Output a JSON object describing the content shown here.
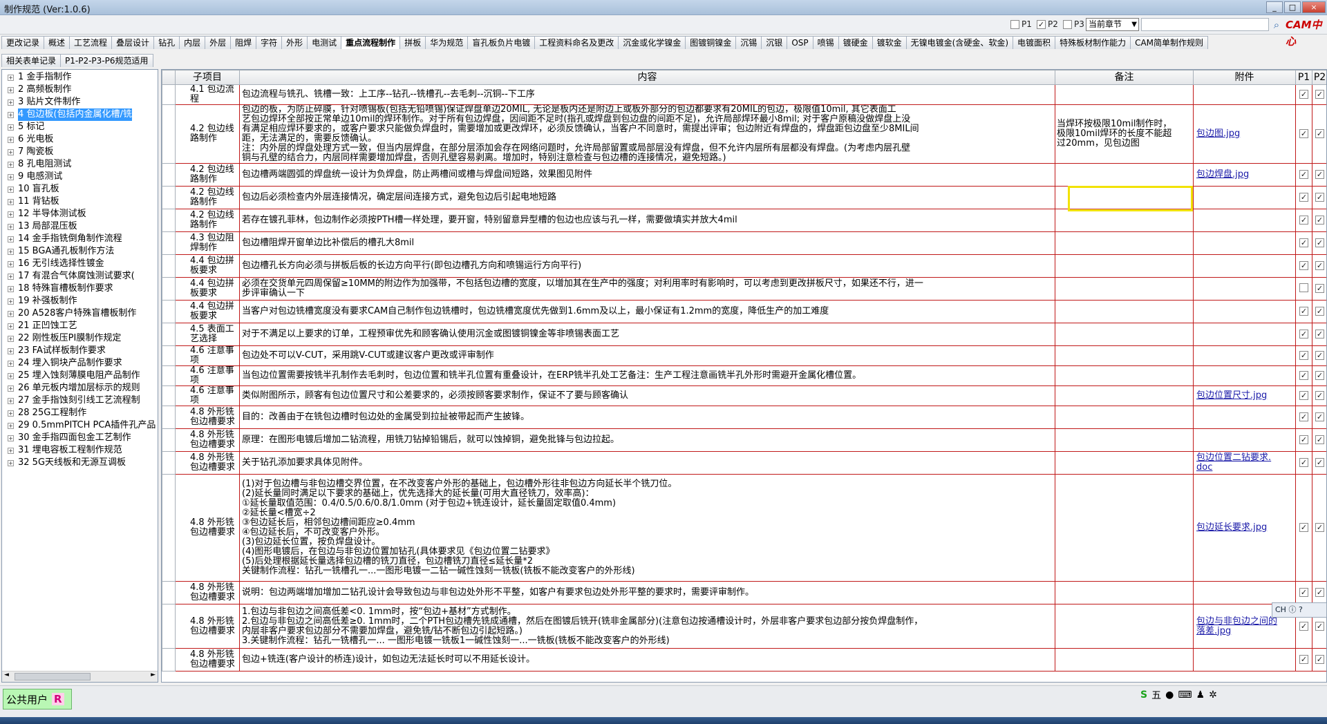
{
  "window": {
    "title": "制作规范 (Ver:1.0.6)",
    "controls": [
      "_",
      "□",
      "×"
    ]
  },
  "toolbar": {
    "p1": "P1",
    "p2": "P2",
    "p3": "P3",
    "chapter": "当前章节",
    "logo": "CAM中心"
  },
  "tabs": [
    "更改记录",
    "概述",
    "工艺流程",
    "叠层设计",
    "钻孔",
    "内层",
    "外层",
    "阻焊",
    "字符",
    "外形",
    "电测试",
    "重点流程制作",
    "拼板",
    "华为规范",
    "盲孔板负片电镀",
    "工程资料命名及更改",
    "沉金或化学镍金",
    "图镀铜镍金",
    "沉锡",
    "沉银",
    "OSP",
    "喷锡",
    "镀硬金",
    "镀软金",
    "无镍电镀金(含硬金、软金)",
    "电镀面积",
    "特殊板材制作能力",
    "CAM简单制作规则"
  ],
  "active_tab": "重点流程制作",
  "tabs2": [
    "相关表单记录",
    "P1-P2-P3-P6规范适用"
  ],
  "sidebar": [
    "1  金手指制作",
    "2  高频板制作",
    "3  贴片文件制作",
    "4  包边板(包括内金属化槽/铣",
    "5  标记",
    "6  光电板",
    "7  陶瓷板",
    "8  孔电阻测试",
    "9  电感测试",
    "10  盲孔板",
    "11  背钻板",
    "12  半导体测试板",
    "13  局部混压板",
    "14  金手指铣倒角制作流程",
    "15  BGA通孔板制作方法",
    "16  无引线选择性镀金",
    "17  有混合气体腐蚀测试要求(",
    "18  特殊盲槽板制作要求",
    "19  补强板制作",
    "20  A528客户特殊盲槽板制作",
    "21  正凹蚀工艺",
    "22  刚性板压PI膜制作规定",
    "23  FA试样板制作要求",
    "24  埋入铜块产品制作要求",
    "25  埋入蚀刻薄膜电阻产品制作",
    "26  单元板内增加层标示的规则",
    "27  金手指蚀刻引线工艺流程制",
    "28  25G工程制作",
    "29  0.5mmPITCH PCA插件孔产品",
    "30  金手指四面包金工艺制作",
    "31  埋电容板工程制作规范",
    "32  5G天线板和无源互调板"
  ],
  "selected_index": 3,
  "columns": {
    "sub": "子项目",
    "content": "内容",
    "note": "备注",
    "att": "附件",
    "p1": "P1",
    "p2": "P2",
    "p3": "P3"
  },
  "rows": [
    {
      "sub": "4.1 包边流程",
      "content": [
        "包边流程与铣孔、铣槽一致：上工序--钻孔--铣槽孔--去毛刺--沉铜--下工序"
      ],
      "note": [],
      "att": [],
      "p": [
        1,
        1,
        1
      ]
    },
    {
      "sub": "4.2 包边线路制作",
      "content": [
        "包边的板，为防止碎膜，针对喷锡板(包括无铅喷锡)保证焊盘单边20MIL, 无论是板内还是附边上或板外部分的包边都要求有20MIL的包边，极限值10mil, 其它表面工",
        "艺包边焊环全部按正常单边10mil的焊环制作。对于所有包边焊盘，因间距不足时(指孔或焊盘到包边盘的间距不足)，允许局部焊环最小8mil; 对于客户原稿没做焊盘上没",
        "有满足相应焊环要求的，或客户要求只能做负焊盘时，需要增加或更改焊环，必须反馈确认，当客户不同意时，需提出评审；包边附近有焊盘的，焊盘距包边盘至少8MIL间",
        "距，无法满足的，需要反馈确认。",
        "注：内外层的焊盘处理方式一致，但当内层焊盘，在部分层添加会存在网络问题时，允许局部留置或局部层没有焊盘，但不允许内层所有层都没有焊盘。(为考虑内层孔壁",
        "铜与孔壁的结合力，内层同样需要增加焊盘，否则孔壁容易剥离。增加时，特别注意检查与包边槽的连接情况，避免短路。)"
      ],
      "note": [
        "当焊环按极限10mil制作时，",
        "极限10mil焊环的长度不能超",
        "过20mm，见包边图"
      ],
      "att": [
        "包边图.jpg"
      ],
      "p": [
        1,
        1,
        1
      ]
    },
    {
      "sub": "4.2 包边线路制作",
      "content": [
        "包边槽两端圆弧的焊盘统一设计为负焊盘，防止两槽间或槽与焊盘间短路，效果图见附件"
      ],
      "note": [],
      "att": [
        "包边焊盘.jpg"
      ],
      "p": [
        1,
        1,
        1
      ]
    },
    {
      "sub": "4.2 包边线路制作",
      "content": [
        "包边后必须检查内外层连接情况，确定层间连接方式，避免包边后引起电地短路"
      ],
      "note": [],
      "att": [],
      "p": [
        1,
        1,
        1
      ]
    },
    {
      "sub": "4.2 包边线路制作",
      "content": [
        "若存在镀孔菲林，包边制作必须按PTH槽一样处理，要开窗，特别留意异型槽的包边也应该与孔一样，需要做填实并放大4mil"
      ],
      "note": [],
      "att": [],
      "p": [
        1,
        1,
        1
      ]
    },
    {
      "sub": "4.3 包边阻焊制作",
      "content": [
        "包边槽阻焊开窗单边比补偿后的槽孔大8mil"
      ],
      "note": [],
      "att": [],
      "p": [
        1,
        1,
        1
      ]
    },
    {
      "sub": "4.4 包边拼板要求",
      "content": [
        "包边槽孔长方向必须与拼板后板的长边方向平行(即包边槽孔方向和喷锡运行方向平行)"
      ],
      "note": [],
      "att": [],
      "p": [
        1,
        1,
        1
      ]
    },
    {
      "sub": "4.4 包边拼板要求",
      "content": [
        "必须在交货单元四周保留≥10MM的附边作为加强带，不包括包边槽的宽度，以增加其在生产中的强度；对利用率时有影响时，可以考虑到更改拼板尺寸，如果还不行，进一",
        "步评审确认一下"
      ],
      "note": [],
      "att": [],
      "p": [
        0,
        1,
        0
      ]
    },
    {
      "sub": "4.4 包边拼板要求",
      "content": [
        "当客户对包边铣槽宽度没有要求CAM自己制作包边铣槽时，包边铣槽宽度优先做到1.6mm及以上，最小保证有1.2mm的宽度，降低生产的加工难度"
      ],
      "note": [],
      "att": [],
      "p": [
        1,
        1,
        1
      ]
    },
    {
      "sub": "4.5 表面工艺选择",
      "content": [
        "对于不满足以上要求的订单，工程预审优先和顾客确认使用沉金或图镀铜镍金等非喷锡表面工艺"
      ],
      "note": [],
      "att": [],
      "p": [
        1,
        1,
        1
      ]
    },
    {
      "sub": "4.6 注意事项",
      "content": [
        "包边处不可以V-CUT，采用跳V-CUT或建议客户更改或评审制作"
      ],
      "note": [],
      "att": [],
      "p": [
        1,
        1,
        1
      ]
    },
    {
      "sub": "4.6 注意事项",
      "content": [
        "当包边位置需要按铣半孔制作去毛刺时，包边位置和铣半孔位置有重叠设计，在ERP铣半孔处工艺备注：生产工程注意画铣半孔外形时需避开金属化槽位置。"
      ],
      "note": [],
      "att": [],
      "p": [
        1,
        1,
        1
      ]
    },
    {
      "sub": "4.6 注意事项",
      "content": [
        "类似附图所示，顾客有包边位置尺寸和公差要求的，必须按顾客要求制作，保证不了要与顾客确认"
      ],
      "note": [],
      "att": [
        "包边位置尺寸.jpg"
      ],
      "p": [
        1,
        1,
        1
      ]
    },
    {
      "sub": "4.8 外形铣包边槽要求",
      "content": [
        "目的：改善由于在铣包边槽时包边处的金属受到拉扯被带起而产生披锋。"
      ],
      "note": [],
      "att": [],
      "p": [
        1,
        1,
        1
      ]
    },
    {
      "sub": "4.8 外形铣包边槽要求",
      "content": [
        "原理：在图形电镀后增加二钻流程，用铣刀钻掉铅锡后，就可以蚀掉铜，避免批锋与包边拉起。"
      ],
      "note": [],
      "att": [],
      "p": [
        1,
        1,
        1
      ]
    },
    {
      "sub": "4.8 外形铣包边槽要求",
      "content": [
        "关于钻孔添加要求具体见附件。"
      ],
      "note": [],
      "att": [
        "包边位置二钻要求.",
        "doc"
      ],
      "p": [
        1,
        1,
        1
      ]
    },
    {
      "sub": "4.8 外形铣包边槽要求",
      "content": [
        " (1)对于包边槽与非包边槽交界位置，在不改变客户外形的基础上，包边槽外形往非包边方向延长半个铣刀位。",
        " (2)延长量同时满足以下要求的基础上，优先选择大的延长量(可用大直径铣刀，效率高)：",
        "①延长量取值范围：0.4/0.5/0.6/0.8/1.0mm (对于包边+铣连设计，延长量固定取值0.4mm)",
        "②延长量<槽宽÷2",
        "③包边延长后，相邻包边槽间距应≥0.4mm",
        "④包边延长后，不可改变客户外形。",
        " (3)包边延长位置，按负焊盘设计。",
        " (4)图形电镀后，在包边与非包边位置加钻孔(具体要求见《包边位置二钻要求》",
        " (5)后处理根据延长量选择包边槽的铣刀直径，包边槽铣刀直径≤延长量*2",
        "关键制作流程：钻孔一铣槽孔一...一图形电镀一二钻一碱性蚀刻一铣板(铣板不能改变客户的外形线)"
      ],
      "note": [],
      "att": [
        "包边延长要求.jpg"
      ],
      "p": [
        1,
        1,
        1
      ]
    },
    {
      "sub": "4.8 外形铣包边槽要求",
      "content": [
        "说明：包边两端增加增加二钻孔设计会导致包边与非包边处外形不平整，如客户有要求包边处外形平整的要求时，需要评审制作。"
      ],
      "note": [],
      "att": [],
      "p": [
        1,
        1,
        1
      ]
    },
    {
      "sub": "4.8 外形铣包边槽要求",
      "content": [
        "1.包边与非包边之间高低差<0. 1mm时，按“包边+基材”方式制作。",
        "2.包边与非包边之间高低差≥0. 1mm时，二个PTH包边槽先铣成通槽，然后在图镀后铣开(铣非金属部分)(注意包边按通槽设计时，外层非客户要求包边部分按负焊盘制作，",
        "内层非客户要求包边部分不需要加焊盘，避免铣/钻不断包边引起短路。)",
        "3.关键制作流程：钻孔一铣槽孔一... 一图形电镀一铣板1一碱性蚀刻一...一铣板(铣板不能改变客户的外形线)"
      ],
      "note": [],
      "att": [
        "包边与非包边之间的",
        "落差.jpg"
      ],
      "p": [
        1,
        1,
        1
      ]
    },
    {
      "sub": "4.8 外形铣包边槽要求",
      "content": [
        "包边+铣连(客户设计的桥连)设计，如包边无法延长时可以不用延长设计。"
      ],
      "note": [],
      "att": [],
      "p": [
        1,
        1,
        1
      ]
    }
  ],
  "tooltip_text": "焊盘距包边盘至少8MIL间",
  "status": {
    "user": "公共用户",
    "role": "R",
    "ime": "五"
  }
}
